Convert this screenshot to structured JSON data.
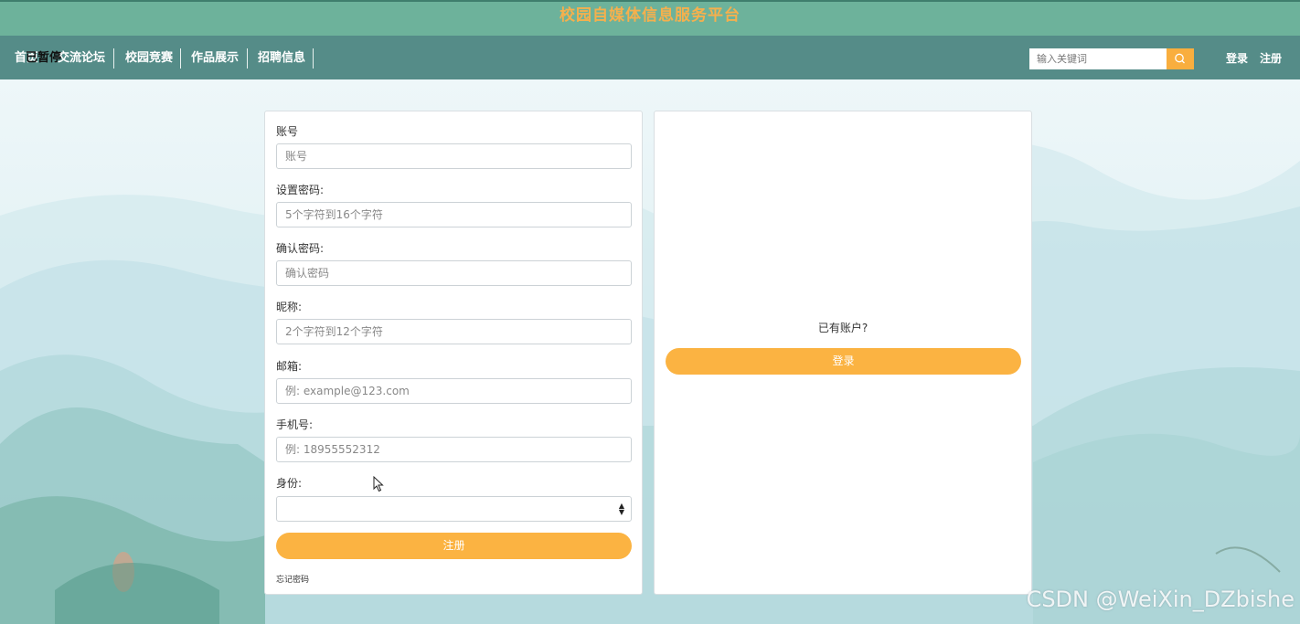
{
  "header": {
    "site_title": "校园自媒体信息服务平台"
  },
  "nav": {
    "items": [
      {
        "label": "首页"
      },
      {
        "label": "交流论坛"
      },
      {
        "label": "校园竞赛"
      },
      {
        "label": "作品展示"
      },
      {
        "label": "招聘信息"
      }
    ],
    "overlay_label": "已暂停",
    "search_placeholder": "输入关键词",
    "login": "登录",
    "register": "注册"
  },
  "register_form": {
    "fields": [
      {
        "label": "账号",
        "placeholder": "账号"
      },
      {
        "label": "设置密码:",
        "placeholder": "5个字符到16个字符"
      },
      {
        "label": "确认密码:",
        "placeholder": "确认密码"
      },
      {
        "label": "昵称:",
        "placeholder": "2个字符到12个字符"
      },
      {
        "label": "邮箱:",
        "placeholder": "例: example@123.com"
      },
      {
        "label": "手机号:",
        "placeholder": "例: 18955552312"
      }
    ],
    "role_label": "身份:",
    "role_value": "",
    "submit_label": "注册",
    "forgot_label": "忘记密码"
  },
  "login_panel": {
    "prompt": "已有账户?",
    "button_label": "登录"
  },
  "watermark": "CSDN @WeiXin_DZbishe",
  "colors": {
    "title_bar": "#6db29b",
    "nav_bar": "#558c88",
    "accent": "#fbb342",
    "title_text": "#f5b04d"
  }
}
